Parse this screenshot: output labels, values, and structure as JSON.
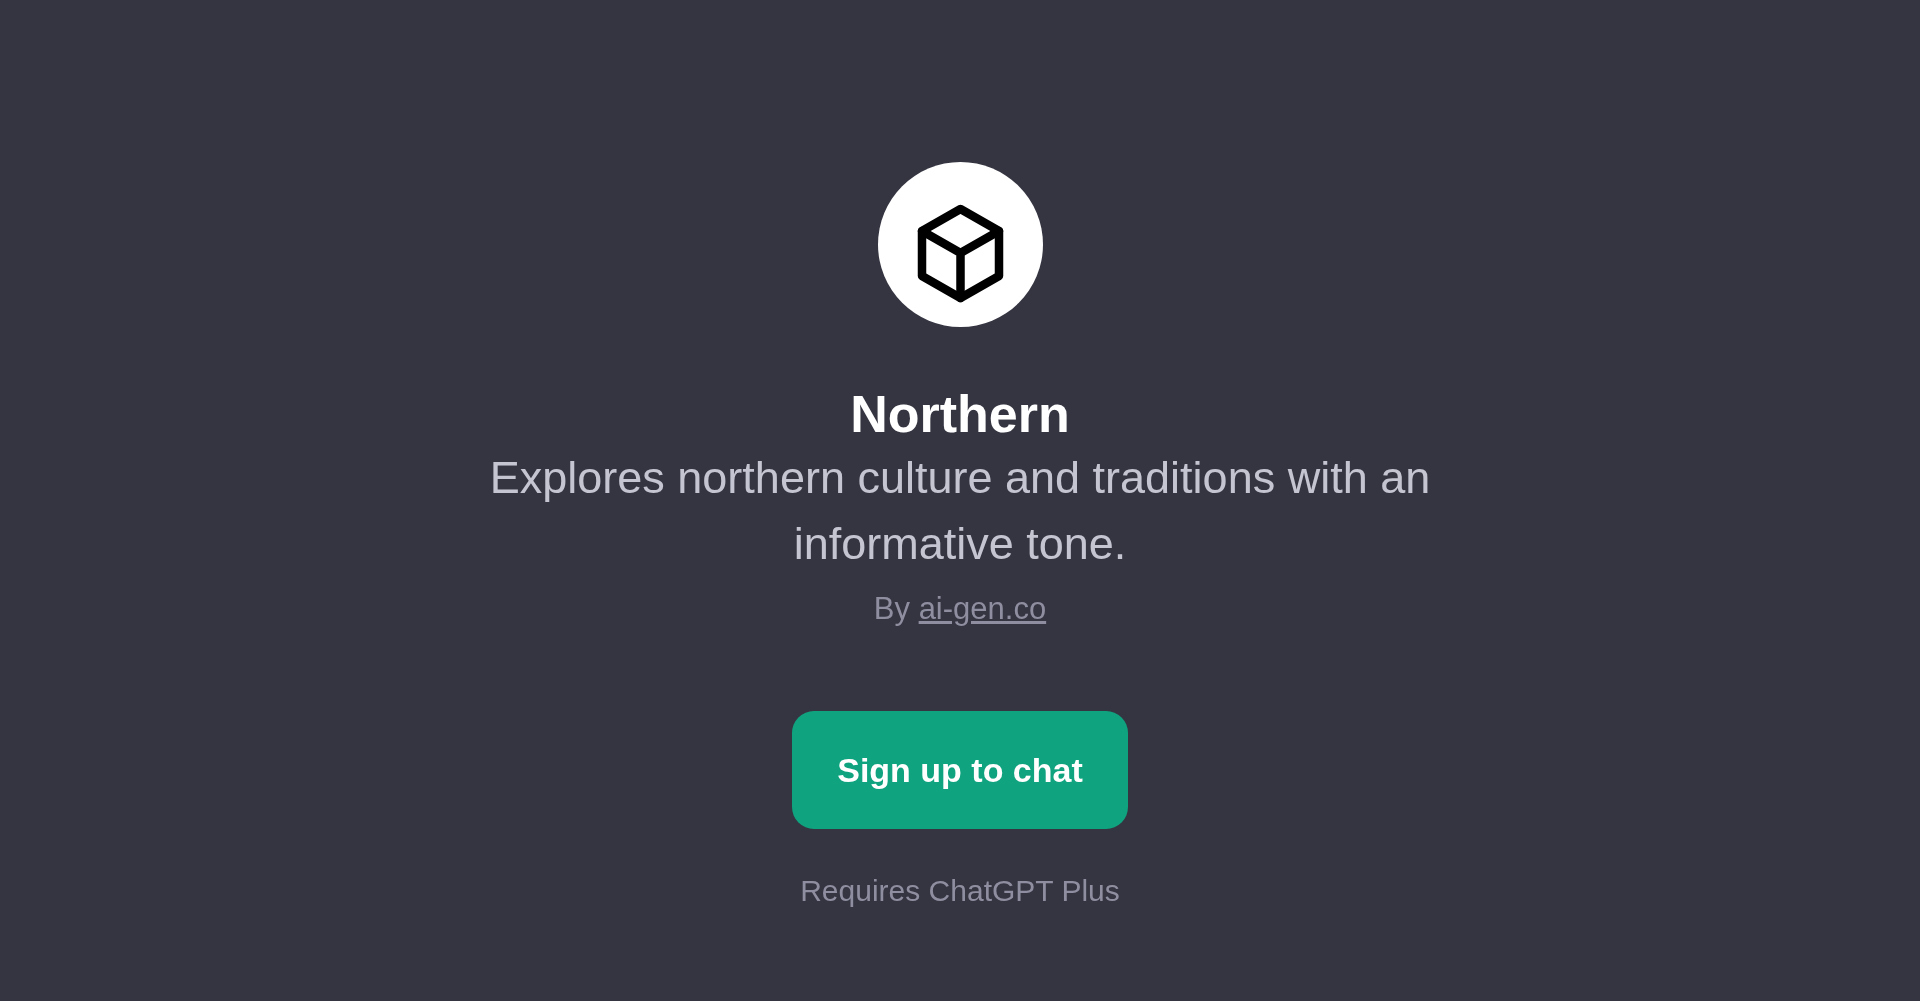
{
  "gpt": {
    "name": "Northern",
    "description": "Explores northern culture and traditions with an informative tone.",
    "author_prefix": "By",
    "author_link": "ai-gen.co"
  },
  "signup_button": {
    "label": "Sign up to chat"
  },
  "requirement_note": "Requires ChatGPT Plus"
}
